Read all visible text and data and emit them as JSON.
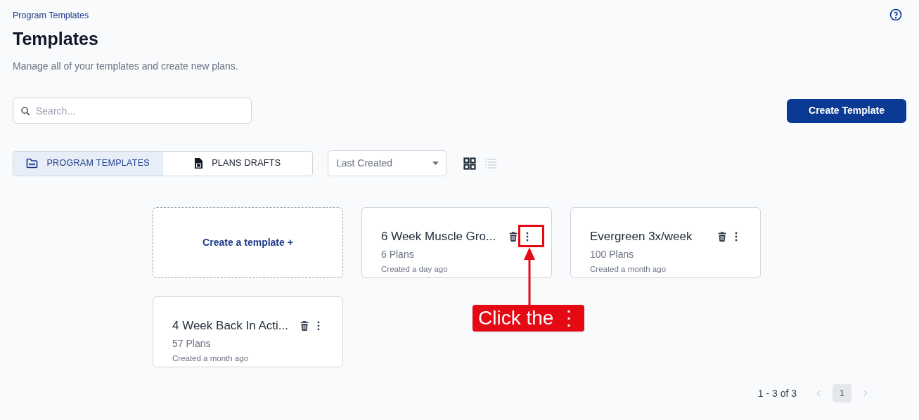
{
  "breadcrumb": "Program Templates",
  "title": "Templates",
  "description": "Manage all of your templates and create new plans.",
  "search": {
    "placeholder": "Search..."
  },
  "create_button": "Create Template",
  "tabs": [
    {
      "label": "PROGRAM TEMPLATES",
      "selected": true,
      "kind": "folder"
    },
    {
      "label": "PLANS DRAFTS",
      "selected": false,
      "kind": "file"
    }
  ],
  "sort": {
    "value": "Last Created"
  },
  "view_toggle": [
    {
      "kind": "grid",
      "selected": true
    },
    {
      "kind": "list",
      "selected": false
    }
  ],
  "cards": [
    {
      "kind": "create",
      "label": "Create a template +"
    },
    {
      "kind": "template",
      "name": "6 Week Muscle Gro...",
      "plans": "6 Plans",
      "created": "Created a day ago",
      "highlighted": true
    },
    {
      "kind": "template",
      "name": "Evergreen 3x/week",
      "plans": "100 Plans",
      "created": "Created a month ago",
      "highlighted": false
    },
    {
      "kind": "template",
      "name": "4 Week Back In Acti...",
      "plans": "57 Plans",
      "created": "Created a month ago",
      "highlighted": false
    }
  ],
  "annotation": {
    "text": "Click the ⋮"
  },
  "pagination": {
    "range": "1 - 3 of 3",
    "pages": [
      {
        "label": "1",
        "selected": true
      }
    ]
  }
}
